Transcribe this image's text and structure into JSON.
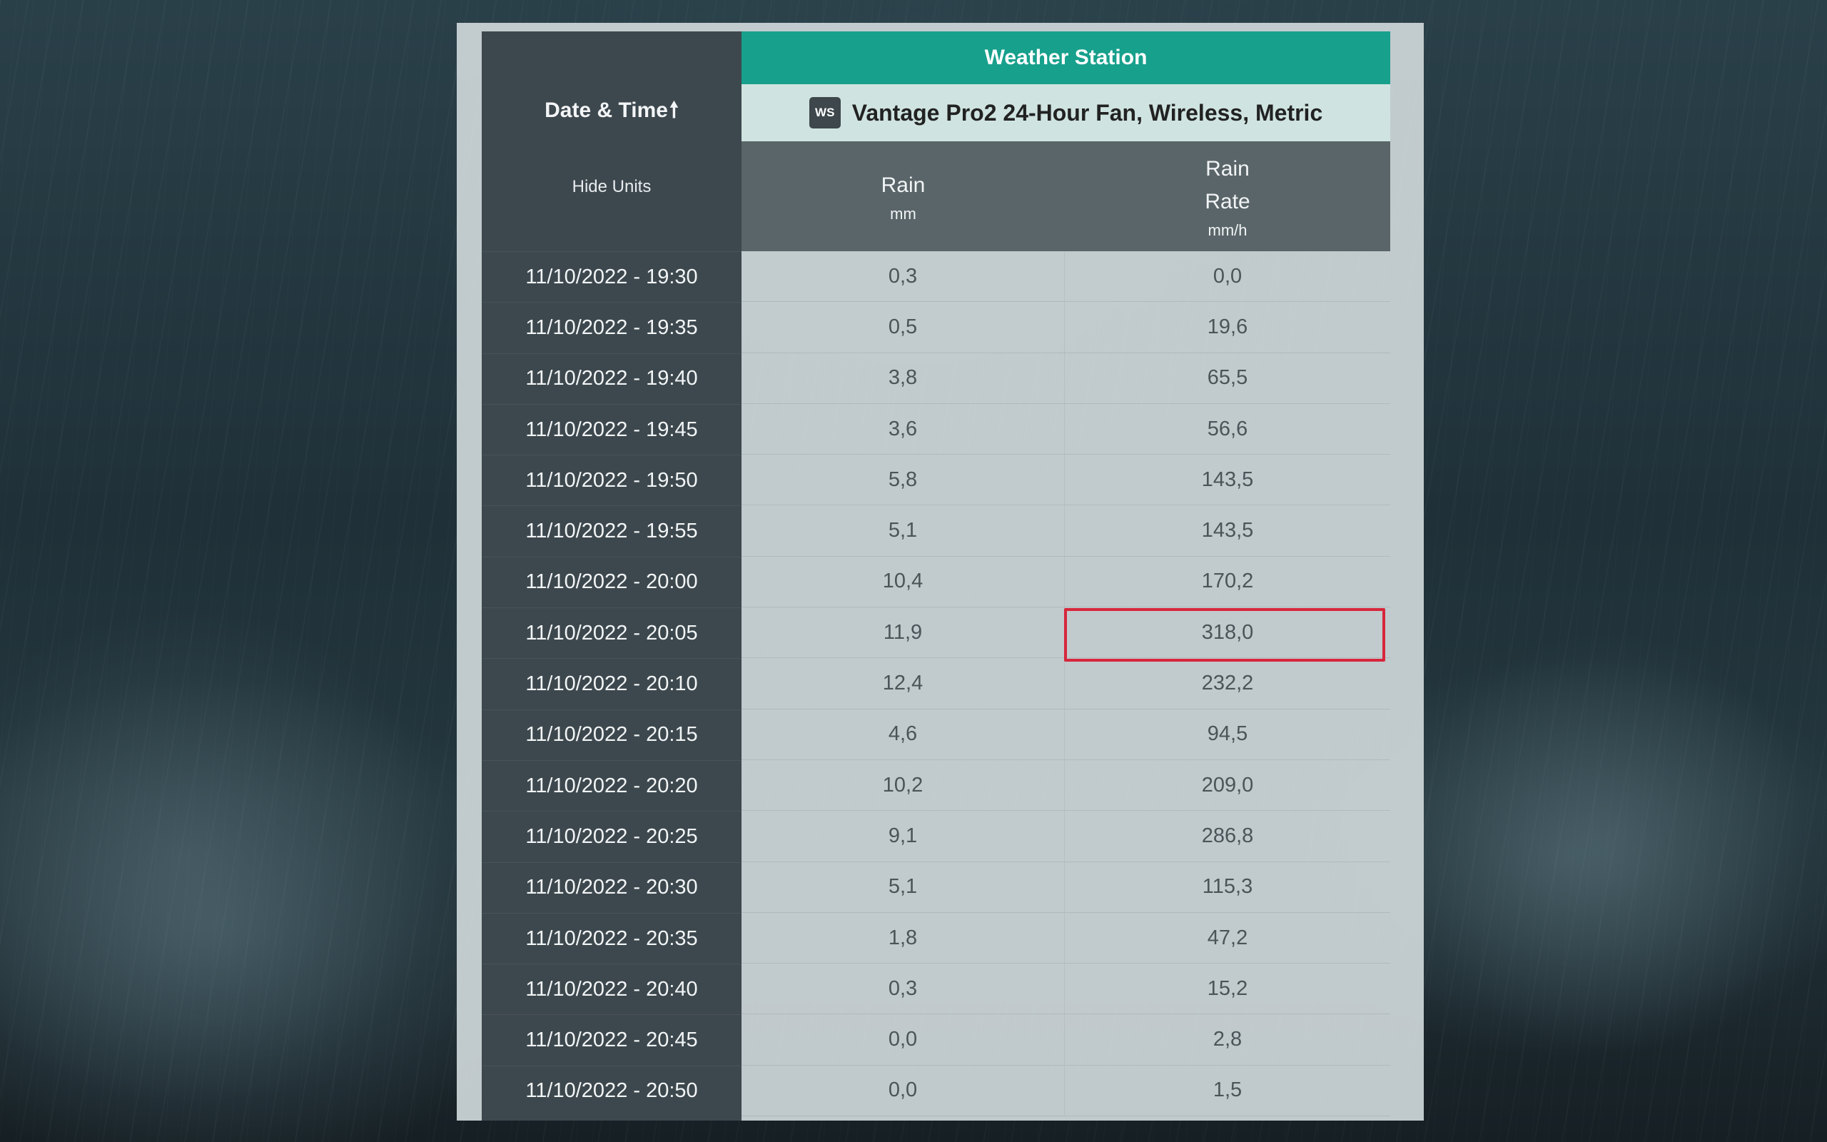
{
  "table": {
    "group_header": "Weather Station",
    "device": {
      "badge": "WS",
      "name": "Vantage Pro2 24-Hour Fan, Wireless, Metric"
    },
    "date_time_header": "Date & Time",
    "sort_icon": "arrow-up-icon",
    "hide_units_label": "Hide Units",
    "columns": [
      {
        "name_line1": "Rain",
        "name_line2": "",
        "unit": "mm"
      },
      {
        "name_line1": "Rain",
        "name_line2": "Rate",
        "unit": "mm/h"
      }
    ],
    "rows": [
      {
        "datetime": "11/10/2022 - 19:30",
        "rain": "0,3",
        "rate": "0,0"
      },
      {
        "datetime": "11/10/2022 - 19:35",
        "rain": "0,5",
        "rate": "19,6"
      },
      {
        "datetime": "11/10/2022 - 19:40",
        "rain": "3,8",
        "rate": "65,5"
      },
      {
        "datetime": "11/10/2022 - 19:45",
        "rain": "3,6",
        "rate": "56,6"
      },
      {
        "datetime": "11/10/2022 - 19:50",
        "rain": "5,8",
        "rate": "143,5"
      },
      {
        "datetime": "11/10/2022 - 19:55",
        "rain": "5,1",
        "rate": "143,5"
      },
      {
        "datetime": "11/10/2022 - 20:00",
        "rain": "10,4",
        "rate": "170,2"
      },
      {
        "datetime": "11/10/2022 - 20:05",
        "rain": "11,9",
        "rate": "318,0"
      },
      {
        "datetime": "11/10/2022 - 20:10",
        "rain": "12,4",
        "rate": "232,2"
      },
      {
        "datetime": "11/10/2022 - 20:15",
        "rain": "4,6",
        "rate": "94,5"
      },
      {
        "datetime": "11/10/2022 - 20:20",
        "rain": "10,2",
        "rate": "209,0"
      },
      {
        "datetime": "11/10/2022 - 20:25",
        "rain": "9,1",
        "rate": "286,8"
      },
      {
        "datetime": "11/10/2022 - 20:30",
        "rain": "5,1",
        "rate": "115,3"
      },
      {
        "datetime": "11/10/2022 - 20:35",
        "rain": "1,8",
        "rate": "47,2"
      },
      {
        "datetime": "11/10/2022 - 20:40",
        "rain": "0,3",
        "rate": "15,2"
      },
      {
        "datetime": "11/10/2022 - 20:45",
        "rain": "0,0",
        "rate": "2,8"
      },
      {
        "datetime": "11/10/2022 - 20:50",
        "rain": "0,0",
        "rate": "1,5"
      }
    ],
    "highlighted_row_index": 7,
    "colors": {
      "header_green": "#17a08c",
      "highlight": "#d7263b",
      "dark_column": "#344046"
    }
  }
}
